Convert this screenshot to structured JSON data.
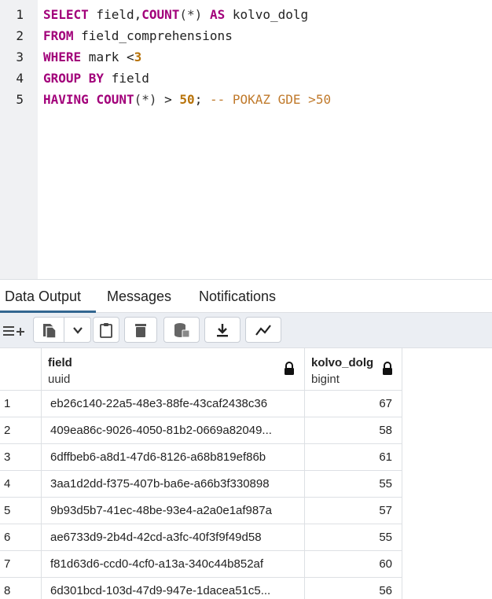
{
  "editor": {
    "lines": [
      {
        "no": "1",
        "tokens": [
          {
            "t": "SELECT",
            "c": "kw"
          },
          {
            "t": " field,",
            "c": ""
          },
          {
            "t": "COUNT",
            "c": "fn"
          },
          {
            "t": "(*)",
            "c": "op"
          },
          {
            "t": " ",
            "c": ""
          },
          {
            "t": "AS",
            "c": "kw"
          },
          {
            "t": " kolvo_dolg",
            "c": ""
          }
        ]
      },
      {
        "no": "2",
        "tokens": [
          {
            "t": "FROM",
            "c": "kw"
          },
          {
            "t": " field_comprehensions",
            "c": ""
          }
        ]
      },
      {
        "no": "3",
        "tokens": [
          {
            "t": "WHERE",
            "c": "kw"
          },
          {
            "t": " mark <",
            "c": ""
          },
          {
            "t": "3",
            "c": "num"
          }
        ]
      },
      {
        "no": "4",
        "tokens": [
          {
            "t": "GROUP BY",
            "c": "kw"
          },
          {
            "t": " field",
            "c": ""
          }
        ]
      },
      {
        "no": "5",
        "tokens": [
          {
            "t": "HAVING",
            "c": "kw"
          },
          {
            "t": " ",
            "c": ""
          },
          {
            "t": "COUNT",
            "c": "fn"
          },
          {
            "t": "(*)",
            "c": "op"
          },
          {
            "t": " > ",
            "c": ""
          },
          {
            "t": "50",
            "c": "num"
          },
          {
            "t": "; ",
            "c": ""
          },
          {
            "t": "-- POKAZ GDE >50",
            "c": "cmt"
          }
        ]
      }
    ]
  },
  "tabs": {
    "data_output": "Data Output",
    "messages": "Messages",
    "notifications": "Notifications"
  },
  "toolbar": {
    "icons": [
      "add-row-icon",
      "copy-icon",
      "chevron-down-icon",
      "paste-icon",
      "delete-icon",
      "save-data-icon",
      "download-icon",
      "graph-icon"
    ]
  },
  "grid": {
    "columns": [
      {
        "name": "field",
        "type": "uuid"
      },
      {
        "name": "kolvo_dolg",
        "type": "bigint"
      }
    ],
    "rows": [
      {
        "idx": "1",
        "field": "eb26c140-22a5-48e3-88fe-43caf2438c36",
        "kolvo_dolg": "67"
      },
      {
        "idx": "2",
        "field": "409ea86c-9026-4050-81b2-0669a82049...",
        "kolvo_dolg": "58"
      },
      {
        "idx": "3",
        "field": "6dffbeb6-a8d1-47d6-8126-a68b819ef86b",
        "kolvo_dolg": "61"
      },
      {
        "idx": "4",
        "field": "3aa1d2dd-f375-407b-ba6e-a66b3f330898",
        "kolvo_dolg": "55"
      },
      {
        "idx": "5",
        "field": "9b93d5b7-41ec-48be-93e4-a2a0e1af987a",
        "kolvo_dolg": "57"
      },
      {
        "idx": "6",
        "field": "ae6733d9-2b4d-42cd-a3fc-40f3f9f49d58",
        "kolvo_dolg": "55"
      },
      {
        "idx": "7",
        "field": "f81d63d6-ccd0-4cf0-a13a-340c44b852af",
        "kolvo_dolg": "60"
      },
      {
        "idx": "8",
        "field": "6d301bcd-103d-47d9-947e-1dacea51c5...",
        "kolvo_dolg": "56"
      }
    ]
  },
  "colors": {
    "keyword": "#a2007a",
    "number": "#b8730a",
    "comment": "#c07a2c",
    "tab_active": "#326690",
    "gutter": "#f0f1f3",
    "toolbar": "#ebeef3"
  }
}
